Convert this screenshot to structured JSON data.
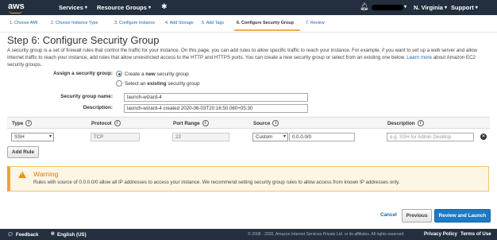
{
  "topnav": {
    "logo": "aws",
    "services": "Services",
    "resource_groups": "Resource Groups",
    "region": "N. Virginia",
    "support": "Support"
  },
  "steps": [
    {
      "label": "1. Choose AMI"
    },
    {
      "label": "2. Choose Instance Type"
    },
    {
      "label": "3. Configure Instance"
    },
    {
      "label": "4. Add Storage"
    },
    {
      "label": "5. Add Tags"
    },
    {
      "label": "6. Configure Security Group"
    },
    {
      "label": "7. Review"
    }
  ],
  "page": {
    "title": "Step 6: Configure Security Group",
    "intro": "A security group is a set of firewall rules that control the traffic for your instance. On this page, you can add rules to allow specific traffic to reach your instance. For example, if you want to set up a web server and allow Internet traffic to reach your instance, add rules that allow unrestricted access to the HTTP and HTTPS ports. You can create a new security group or select from an existing one below.",
    "learn_more": "Learn more",
    "intro_tail": "about Amazon EC2 security groups."
  },
  "form": {
    "assign_label": "Assign a security group:",
    "option_create_prefix": "Create a ",
    "option_create_bold": "new",
    "option_create_suffix": " security group",
    "option_existing_prefix": "Select an ",
    "option_existing_bold": "existing",
    "option_existing_suffix": " security group",
    "name_label": "Security group name:",
    "name_value": "launch-wizard-4",
    "desc_label": "Description:",
    "desc_value": "launch-wizard-4 created 2020-06-03T20:16:50.080+05:30"
  },
  "rules": {
    "headers": {
      "type": "Type",
      "protocol": "Protocol",
      "port_range": "Port Range",
      "source": "Source",
      "description": "Description"
    },
    "row": {
      "type": "SSH",
      "protocol": "TCP",
      "port_range": "22",
      "source_mode": "Custom",
      "source_cidr": "0.0.0.0/0",
      "description_placeholder": "e.g. SSH for Admin Desktop"
    },
    "add_rule": "Add Rule"
  },
  "warning": {
    "title": "Warning",
    "text": "Rules with source of 0.0.0.0/0 allow all IP addresses to access your instance. We recommend setting security group rules to allow access from known IP addresses only."
  },
  "actions": {
    "cancel": "Cancel",
    "previous": "Previous",
    "review_launch": "Review and Launch"
  },
  "footer": {
    "feedback": "Feedback",
    "language": "English (US)",
    "copyright": "© 2008 - 2020, Amazon Internet Services Private Ltd. or its affiliates. All rights reserved.",
    "privacy": "Privacy Policy",
    "terms": "Terms of Use"
  },
  "colors": {
    "nav_bg": "#232f3e",
    "accent": "#ff9900",
    "link": "#1166bb",
    "primary_button": "#1f7ac4",
    "warning": "#e8950c"
  }
}
